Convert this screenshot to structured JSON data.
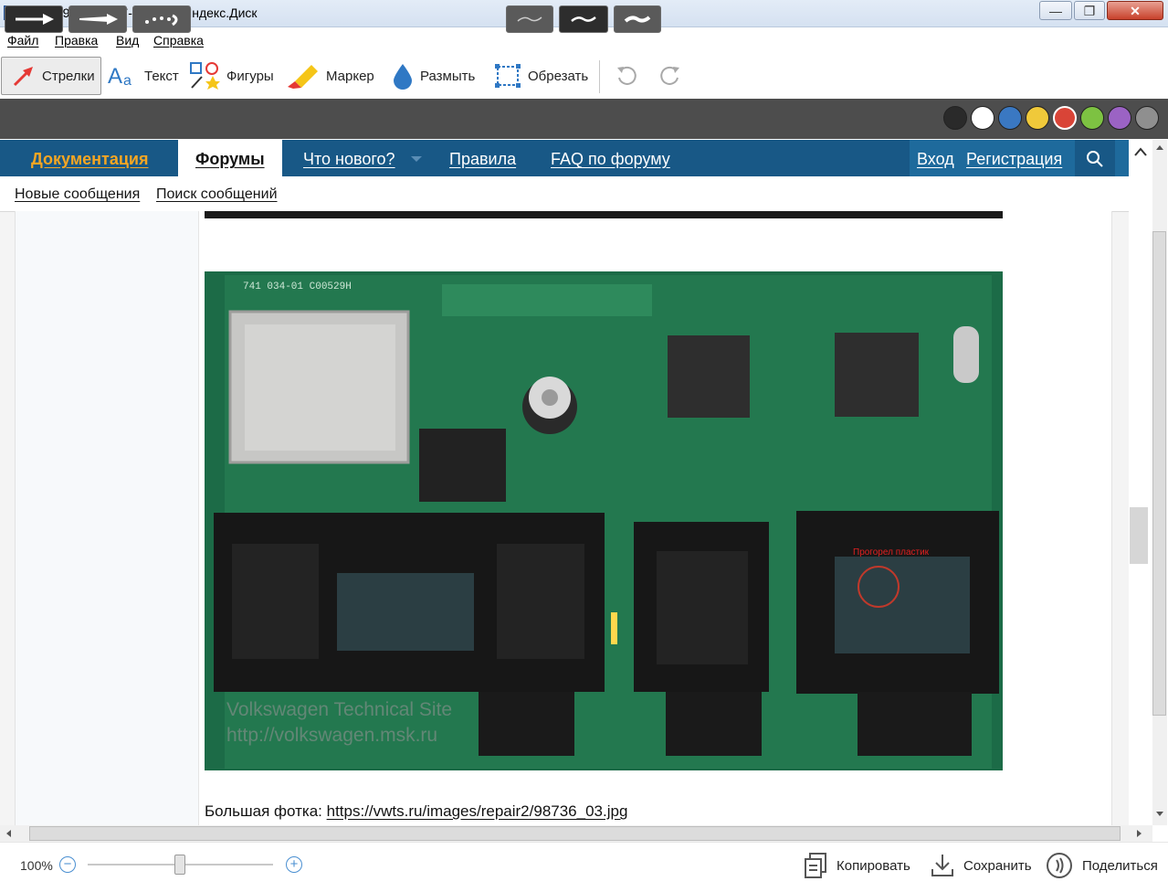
{
  "window": {
    "title": "2024-09-27_23-17-23.png - Яндекс.Диск",
    "min": "—",
    "max": "❐",
    "close": "✕"
  },
  "menu": [
    "Файл",
    "Правка",
    "Вид",
    "Справка"
  ],
  "tools": {
    "arrows": "Стрелки",
    "text": "Текст",
    "shapes": "Фигуры",
    "marker": "Маркер",
    "blur": "Размыть",
    "crop": "Обрезать"
  },
  "colors": {
    "swatches": [
      "#2a2a2a",
      "#ffffff",
      "#3a78c2",
      "#f0c93a",
      "#d94437",
      "#7dc242",
      "#9b63c4",
      "#8f8f8f"
    ],
    "selected": "#d94437",
    "accent": "#185886"
  },
  "forum": {
    "nav": {
      "docs": "Документация",
      "forums": "Форумы",
      "whats_new": "Что нового?",
      "rules": "Правила",
      "faq": "FAQ по форуму",
      "login": "Вход",
      "register": "Регистрация"
    },
    "subnav": {
      "new_posts": "Новые сообщения",
      "search_posts": "Поиск сообщений"
    },
    "photo": {
      "annotation": "Прогорел пластик",
      "watermark1": "Volkswagen Technical Site",
      "watermark2": "http://volkswagen.msk.ru",
      "pcb_code": "741 034-01  C00529H"
    },
    "caption_label": "Большая фотка: ",
    "caption_link": "https://vwts.ru/images/repair2/98736_03.jpg"
  },
  "status": {
    "zoom": "100%",
    "zoom_level": 1.0,
    "copy": "Копировать",
    "save": "Сохранить",
    "share": "Поделиться"
  }
}
